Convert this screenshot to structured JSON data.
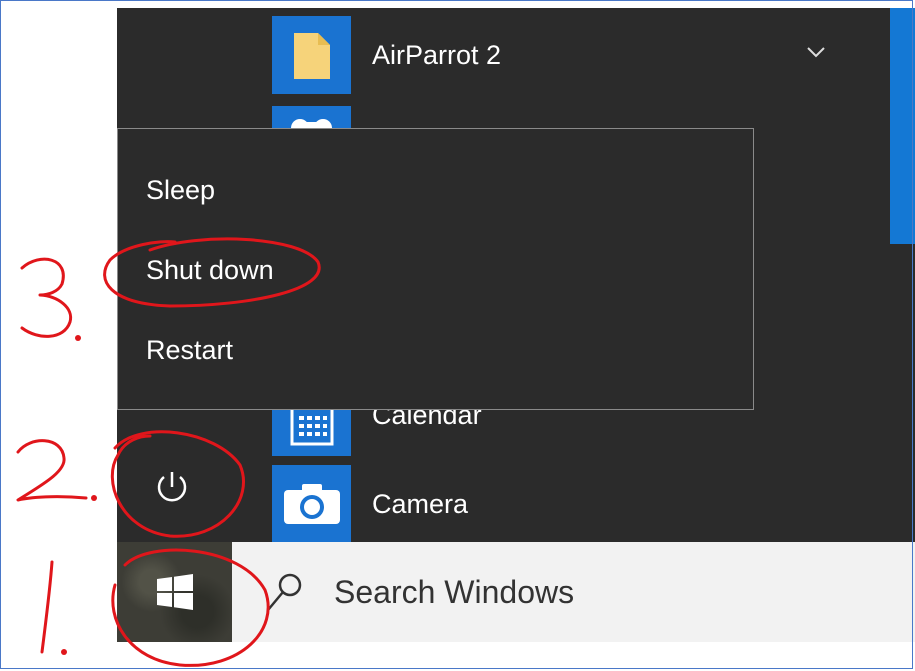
{
  "start_menu": {
    "apps": [
      {
        "label": "AirParrot 2",
        "icon": "folder-icon"
      },
      {
        "label": "Calendar",
        "icon": "calendar-icon"
      },
      {
        "label": "Camera",
        "icon": "camera-icon"
      }
    ],
    "expand_icon": "chevron-down-icon"
  },
  "power_menu": {
    "items": [
      {
        "label": "Sleep"
      },
      {
        "label": "Shut down"
      },
      {
        "label": "Restart"
      }
    ]
  },
  "power_button": {
    "icon": "power-icon"
  },
  "taskbar": {
    "start_icon": "windows-logo-icon",
    "search_icon": "search-icon",
    "search_placeholder": "Search Windows"
  },
  "annotations": {
    "steps": [
      "1.",
      "2.",
      "3."
    ],
    "color": "#e0161b"
  },
  "colors": {
    "accent": "#1a73d1",
    "menu_bg": "#2b2b2b",
    "menu_border": "#8a8a8a"
  }
}
